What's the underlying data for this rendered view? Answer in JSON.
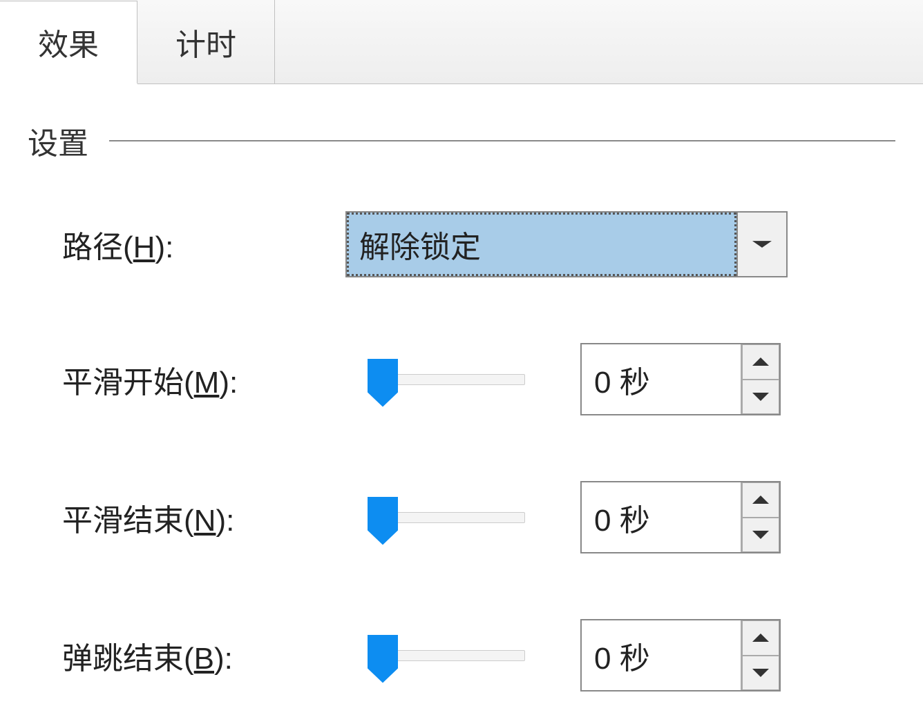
{
  "tabs": {
    "effect": "效果",
    "timing": "计时"
  },
  "section": {
    "settings": "设置"
  },
  "fields": {
    "path": {
      "prefix": "路径(",
      "hotkey": "H",
      "suffix": "):",
      "value": "解除锁定"
    },
    "smooth_start": {
      "prefix": "平滑开始(",
      "hotkey": "M",
      "suffix": "):",
      "value": "0 秒"
    },
    "smooth_end": {
      "prefix": "平滑结束(",
      "hotkey": "N",
      "suffix": "):",
      "value": "0 秒"
    },
    "bounce_end": {
      "prefix": "弹跳结束(",
      "hotkey": "B",
      "suffix": "):",
      "value": "0 秒"
    }
  }
}
